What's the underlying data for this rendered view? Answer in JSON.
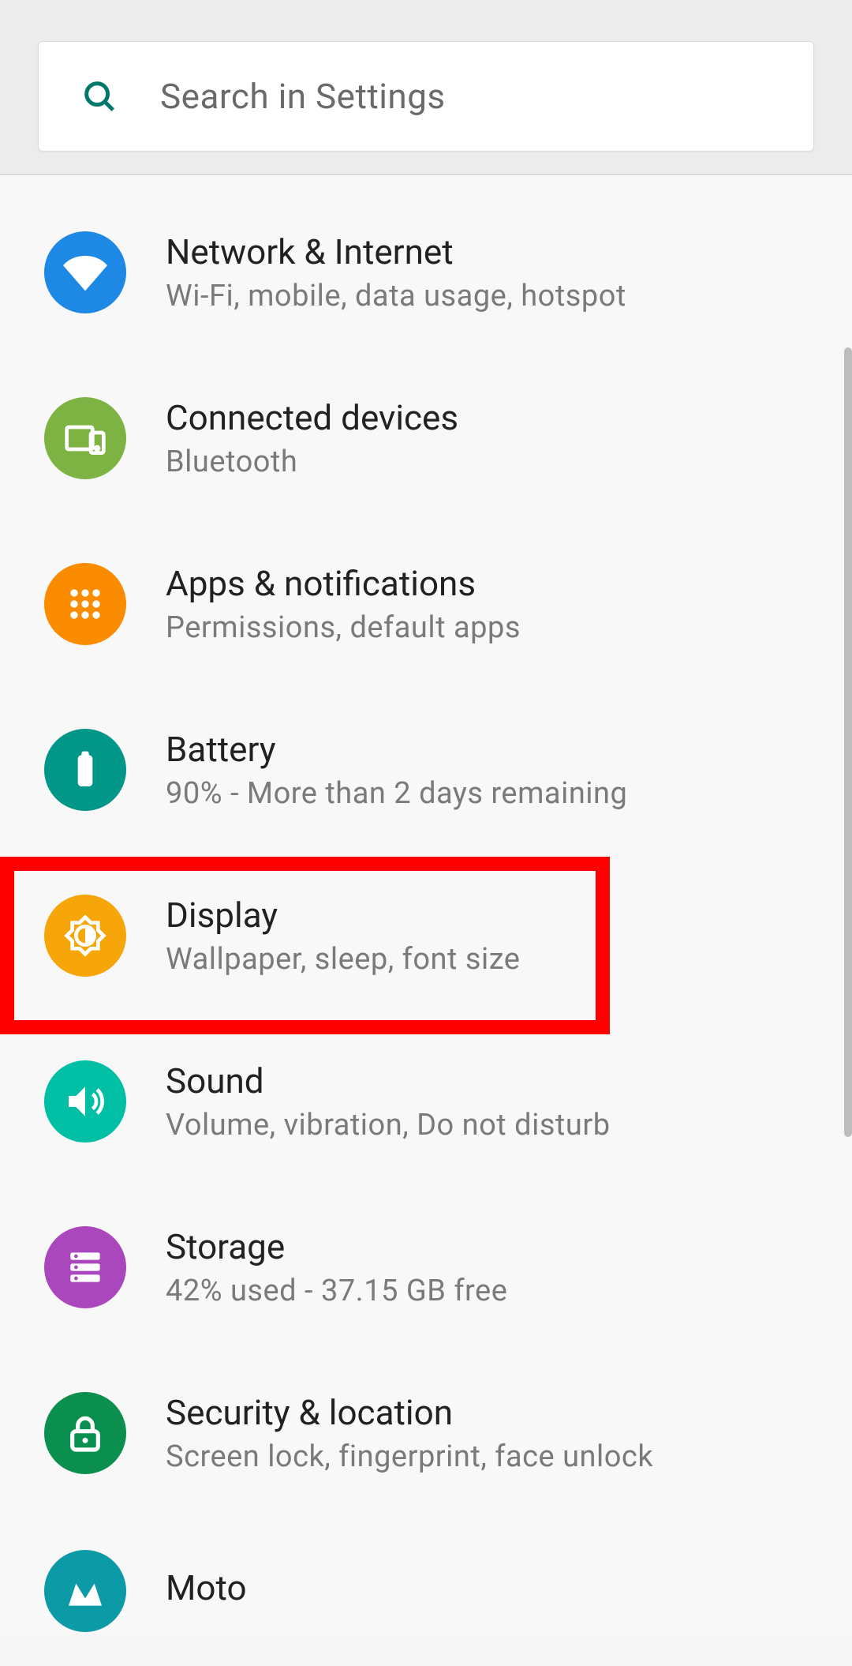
{
  "search": {
    "placeholder": "Search in Settings"
  },
  "highlighted_item_id": "display",
  "items": [
    {
      "id": "network",
      "title": "Network & Internet",
      "subtitle": "Wi-Fi, mobile, data usage, hotspot",
      "icon": "wifi",
      "bg": "bg-blue"
    },
    {
      "id": "connected",
      "title": "Connected devices",
      "subtitle": "Bluetooth",
      "icon": "devices",
      "bg": "bg-green"
    },
    {
      "id": "apps",
      "title": "Apps & notifications",
      "subtitle": "Permissions, default apps",
      "icon": "apps",
      "bg": "bg-orange"
    },
    {
      "id": "battery",
      "title": "Battery",
      "subtitle": "90% - More than 2 days remaining",
      "icon": "battery",
      "bg": "bg-teal"
    },
    {
      "id": "display",
      "title": "Display",
      "subtitle": "Wallpaper, sleep, font size",
      "icon": "brightness",
      "bg": "bg-amber"
    },
    {
      "id": "sound",
      "title": "Sound",
      "subtitle": "Volume, vibration, Do not disturb",
      "icon": "sound",
      "bg": "bg-cyan"
    },
    {
      "id": "storage",
      "title": "Storage",
      "subtitle": "42% used - 37.15 GB free",
      "icon": "storage",
      "bg": "bg-purple"
    },
    {
      "id": "security",
      "title": "Security & location",
      "subtitle": "Screen lock, fingerprint, face unlock",
      "icon": "lock",
      "bg": "bg-dkgreen"
    },
    {
      "id": "moto",
      "title": "Moto",
      "subtitle": "",
      "icon": "moto",
      "bg": "bg-motoblue"
    }
  ]
}
